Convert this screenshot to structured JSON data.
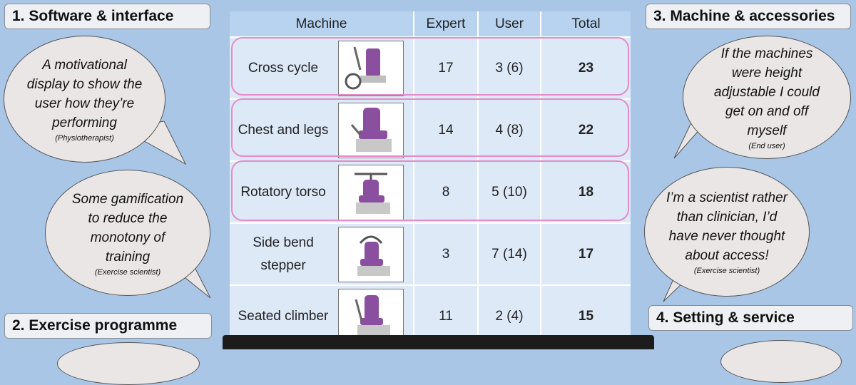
{
  "sections": {
    "s1": "1. Software & interface",
    "s2": "2. Exercise programme",
    "s3": "3. Machine & accessories",
    "s4": "4. Setting & service"
  },
  "quotes": {
    "q1": {
      "text": "A motivational display to show the user how they’re performing",
      "who": "(Physiotherapist)"
    },
    "q2": {
      "text": "Some gamification to reduce the monotony of training",
      "who": "(Exercise scientist)"
    },
    "q3": {
      "text": "If the machines were height adjustable I could get on and off myself",
      "who": "(End user)"
    },
    "q4": {
      "text": "I’m a scientist rather than clinician, I’d have never thought about access!",
      "who": "(Exercise scientist)"
    }
  },
  "table": {
    "headers": [
      "Machine",
      "Expert",
      "User",
      "Total"
    ],
    "rows": [
      {
        "machine": "Cross cycle",
        "expert": "17",
        "user": "3 (6)",
        "total": "23",
        "image": "cross-cycle-machine-image"
      },
      {
        "machine": "Chest and legs",
        "expert": "14",
        "user": "4 (8)",
        "total": "22",
        "image": "chest-and-legs-machine-image"
      },
      {
        "machine": "Rotatory torso",
        "expert": "8",
        "user": "5 (10)",
        "total": "18",
        "image": "rotatory-torso-machine-image"
      },
      {
        "machine": "Side bend stepper",
        "expert": "3",
        "user": "7 (14)",
        "total": "17",
        "image": "side-bend-stepper-machine-image"
      },
      {
        "machine": "Seated climber",
        "expert": "11",
        "user": "2 (4)",
        "total": "15",
        "image": "seated-climber-machine-image"
      }
    ]
  },
  "colors": {
    "background": "#a9c6e6",
    "highlight": "#e48cc8",
    "machine_purple": "#8a4f9e"
  }
}
